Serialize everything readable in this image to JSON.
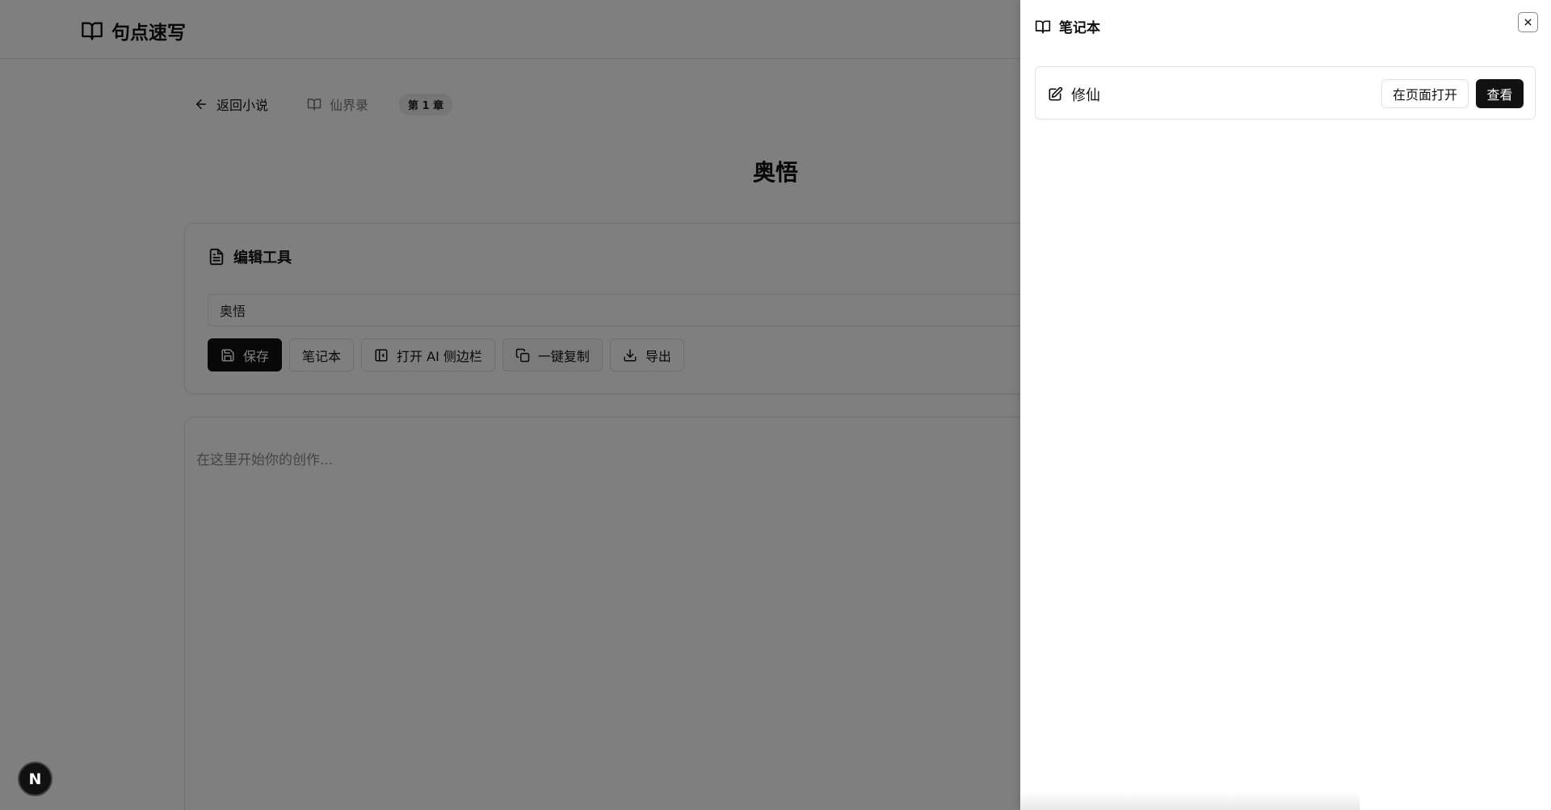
{
  "app": {
    "brand": "句点速写"
  },
  "breadcrumb": {
    "back_label": "返回小说",
    "novel_label": "仙界录",
    "chapter_badge": "第 1 章"
  },
  "chapter": {
    "title": "奥悟"
  },
  "tools": {
    "heading": "编辑工具",
    "title_input_value": "奥悟",
    "buttons": {
      "save": "保存",
      "notebook": "笔记本",
      "ai_sidebar": "打开 AI 侧边栏",
      "copy_all": "一键复制",
      "export": "导出"
    }
  },
  "editor": {
    "placeholder": "在这里开始你的创作..."
  },
  "dev_badge": {
    "letter": "N"
  },
  "sheet": {
    "title": "笔记本",
    "notebooks": [
      {
        "name": "修仙",
        "open_label": "在页面打开",
        "view_label": "查看"
      }
    ]
  }
}
